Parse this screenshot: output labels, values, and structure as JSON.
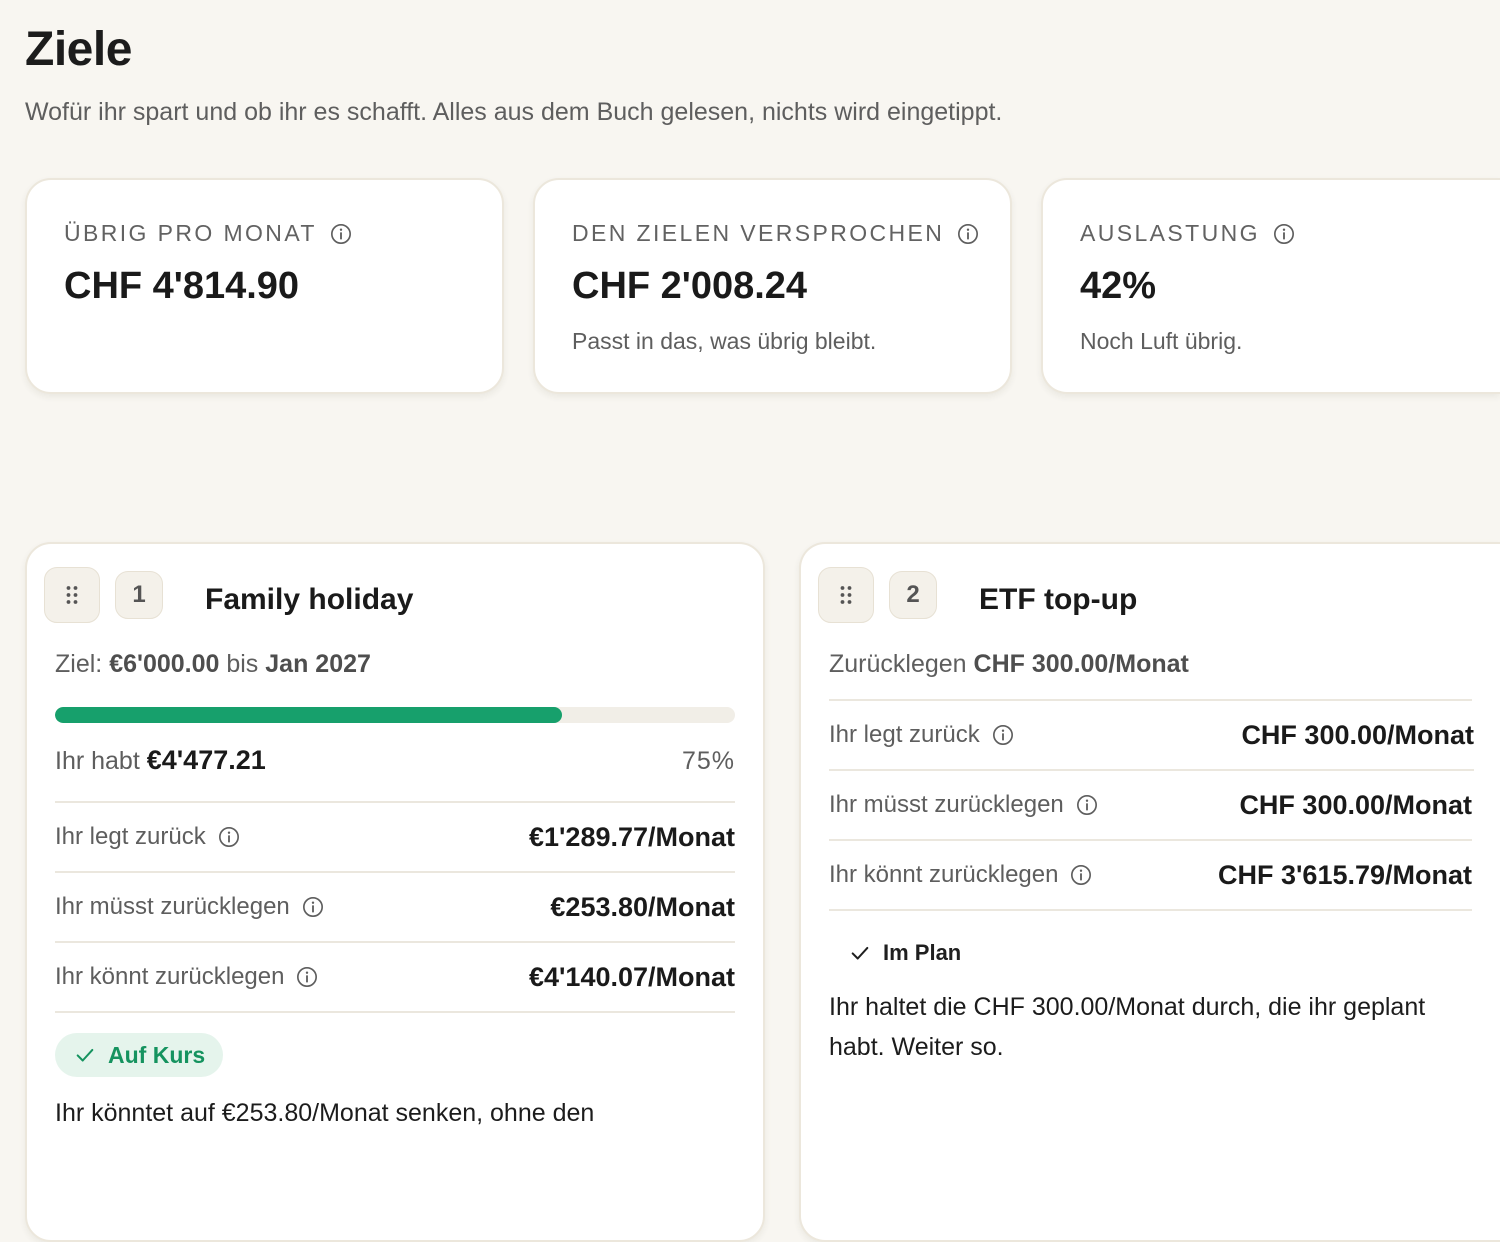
{
  "page": {
    "title": "Ziele",
    "subtitle": "Wofür ihr spart und ob ihr es schafft. Alles aus dem Buch gelesen, nichts wird eingetippt."
  },
  "stats": [
    {
      "label": "Übrig pro Monat",
      "value": "CHF 4'814.90",
      "note": ""
    },
    {
      "label": "Den Zielen versprochen",
      "value": "CHF 2'008.24",
      "note": "Passt in das, was übrig bleibt."
    },
    {
      "label": "Auslastung",
      "value": "42%",
      "note": "Noch Luft übrig."
    }
  ],
  "goals": [
    {
      "number": "1",
      "title": "Family holiday",
      "target_prefix": "Ziel: ",
      "target_amount": "€6'000.00",
      "target_mid": " bis ",
      "target_date": "Jan 2027",
      "progress_fraction": 0.745,
      "have_prefix": "Ihr habt ",
      "have_amount": "€4'477.21",
      "progress_percent": "75%",
      "metrics": [
        {
          "label": "Ihr legt zurück",
          "value": "€1'289.77/Monat"
        },
        {
          "label": "Ihr müsst zurücklegen",
          "value": "€253.80/Monat"
        },
        {
          "label": "Ihr könnt zurücklegen",
          "value": "€4'140.07/Monat"
        }
      ],
      "status": "Auf Kurs",
      "status_color": "#15935f",
      "description": "Ihr könntet auf €253.80/Monat senken, ohne den"
    },
    {
      "number": "2",
      "title": "ETF top-up",
      "plan_prefix": "Zurücklegen ",
      "plan_amount": "CHF 300.00/Monat",
      "metrics": [
        {
          "label": "Ihr legt zurück",
          "value": "CHF 300.00/Monat"
        },
        {
          "label": "Ihr müsst zurücklegen",
          "value": "CHF 300.00/Monat"
        },
        {
          "label": "Ihr könnt zurücklegen",
          "value": "CHF 3'615.79/Monat"
        }
      ],
      "status": "Im Plan",
      "description": "Ihr haltet die CHF 300.00/Monat durch, die ihr geplant habt. Weiter so."
    }
  ],
  "colors": {
    "background": "#f8f6f1",
    "progress": "#17a06c",
    "success": "#15935f"
  },
  "icons": [
    "info-icon",
    "drag-handle-icon",
    "check-icon"
  ]
}
